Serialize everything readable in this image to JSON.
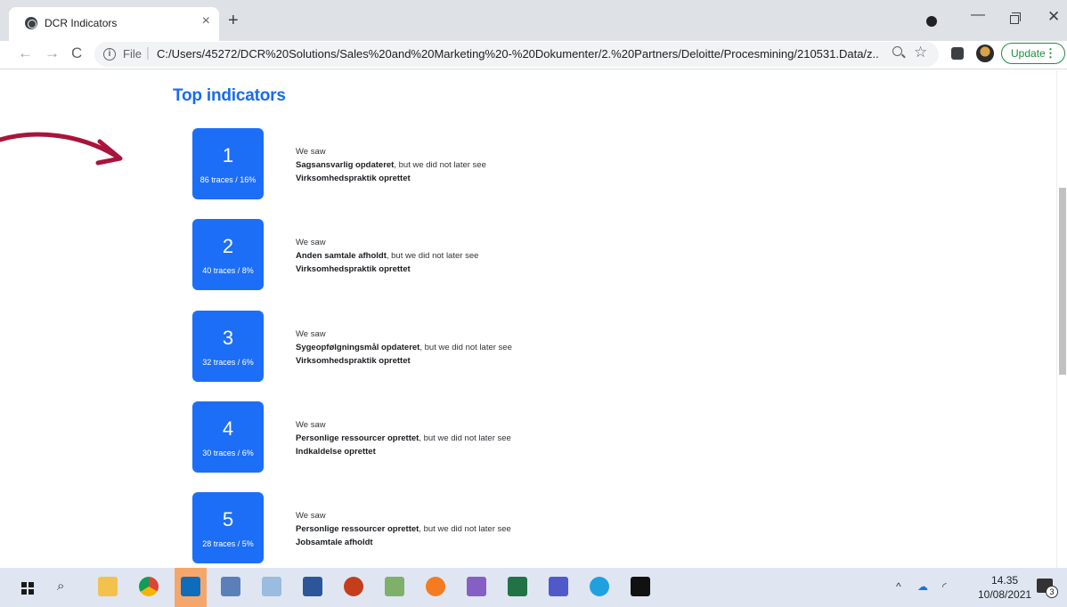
{
  "browser": {
    "tab_title": "DCR Indicators",
    "tab_close": "×",
    "new_tab": "+",
    "url_scheme": "File",
    "url": "C:/Users/45272/DCR%20Solutions/Sales%20and%20Marketing%20-%20Dokumenter/2.%20Partners/Deloitte/Procesmining/210531.Data/z...",
    "update_label": "Update",
    "update_menu": "⋮"
  },
  "page": {
    "title": "Top indicators",
    "indicators": [
      {
        "rank": "1",
        "stats": "86 traces / 16%",
        "intro": "We saw",
        "event": "Sagsansvarlig opdateret",
        "connector": ", but we did not later see",
        "missing": "Virksomhedspraktik oprettet"
      },
      {
        "rank": "2",
        "stats": "40 traces / 8%",
        "intro": "We saw",
        "event": "Anden samtale afholdt",
        "connector": ", but we did not later see",
        "missing": "Virksomhedspraktik oprettet"
      },
      {
        "rank": "3",
        "stats": "32 traces / 6%",
        "intro": "We saw",
        "event": "Sygeopfølgningsmål opdateret",
        "connector": ", but we did not later see",
        "missing": "Virksomhedspraktik oprettet"
      },
      {
        "rank": "4",
        "stats": "30 traces / 6%",
        "intro": "We saw",
        "event": "Personlige ressourcer oprettet",
        "connector": ", but we did not later see",
        "missing": "Indkaldelse oprettet"
      },
      {
        "rank": "5",
        "stats": "28 traces / 5%",
        "intro": "We saw",
        "event": "Personlige ressourcer oprettet",
        "connector": ", but we did not later see",
        "missing": "Jobsamtale afholdt"
      }
    ]
  },
  "annotation": {
    "arrow_color": "#a8143c"
  },
  "taskbar": {
    "time": "14.35",
    "date": "10/08/2021",
    "notification_count": "3"
  },
  "colors": {
    "accent": "#1d6ef7",
    "title": "#1a6af0"
  }
}
